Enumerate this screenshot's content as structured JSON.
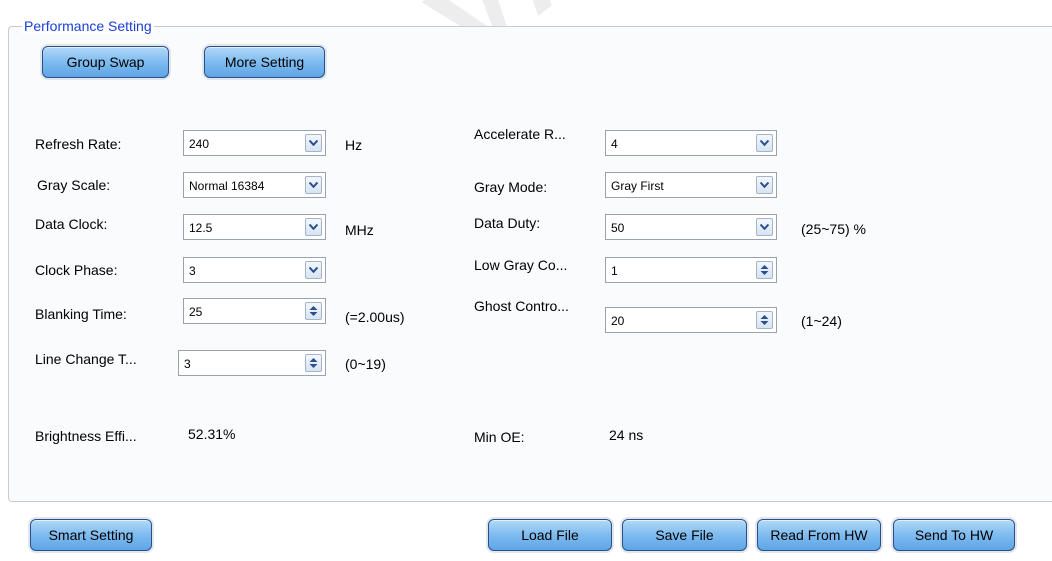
{
  "group_title": "Performance Setting",
  "top_buttons": {
    "group_swap": "Group Swap",
    "more_setting": "More Setting"
  },
  "left": {
    "refresh_rate": {
      "label": "Refresh Rate:",
      "value": "240",
      "unit": "Hz"
    },
    "gray_scale": {
      "label": "Gray Scale:",
      "value": "Normal 16384"
    },
    "data_clock": {
      "label": "Data Clock:",
      "value": "12.5",
      "unit": "MHz"
    },
    "clock_phase": {
      "label": "Clock Phase:",
      "value": "3"
    },
    "blanking_time": {
      "label": "Blanking Time:",
      "value": "25",
      "note": "(=2.00us)"
    },
    "line_change": {
      "label": "Line Change T...",
      "value": "3",
      "note": "(0~19)"
    },
    "brightness": {
      "label": "Brightness Effi...",
      "value": "52.31%"
    }
  },
  "right": {
    "accelerate": {
      "label": "Accelerate R...",
      "value": "4"
    },
    "gray_mode": {
      "label": "Gray Mode:",
      "value": "Gray First"
    },
    "data_duty": {
      "label": "Data Duty:",
      "value": "50",
      "note": "(25~75) %"
    },
    "low_gray": {
      "label": "Low Gray Co...",
      "value": "1"
    },
    "ghost_control": {
      "label": "Ghost Contro...",
      "value": "20",
      "note": "(1~24)"
    },
    "min_oe": {
      "label": "Min OE:",
      "value": "24 ns"
    }
  },
  "bottom_buttons": {
    "smart_setting": "Smart Setting",
    "load_file": "Load File",
    "save_file": "Save File",
    "read_from_hw": "Read From HW",
    "send_to_hw": "Send To HW"
  },
  "watermark": "AN NOVASTAR TEC",
  "icons": {
    "dropdown": "chevron-down-icon",
    "spinner": "spinner-arrows-icon"
  },
  "colors": {
    "legend": "#1b3fd6",
    "button_top": "#b2d9f8",
    "button_bottom": "#5ea5e6",
    "chevron": "#2b4f8a"
  }
}
